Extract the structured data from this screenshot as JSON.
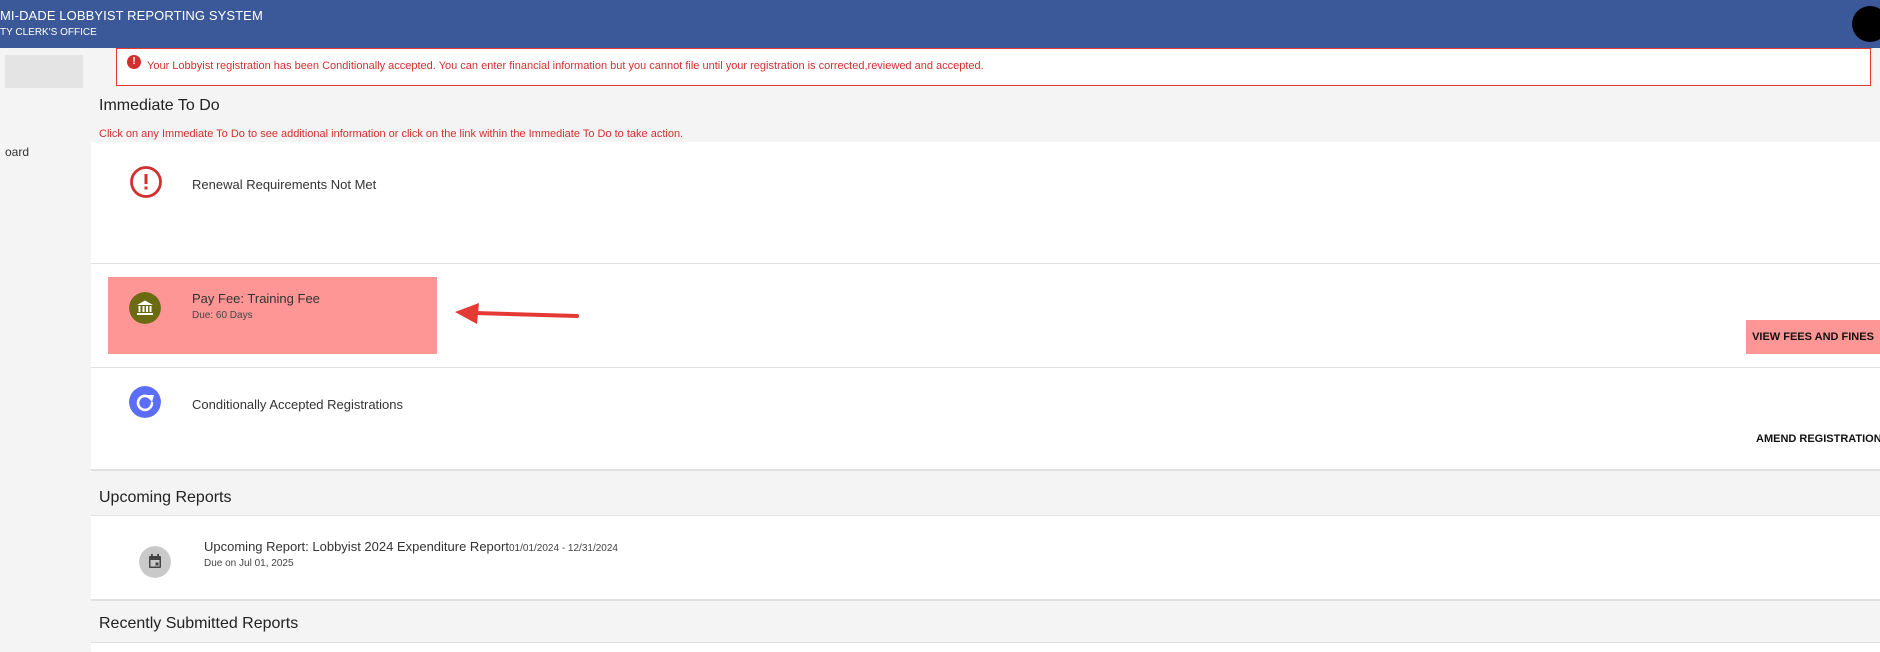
{
  "header": {
    "title": "MI-DADE LOBBYIST REPORTING SYSTEM",
    "subtitle": "TY CLERK'S OFFICE"
  },
  "sidebar": {
    "items": [
      {
        "label": ""
      },
      {
        "label": "oard"
      }
    ]
  },
  "alert": {
    "text": "Your Lobbyist registration has been Conditionally accepted. You can enter financial information but you cannot file until your registration is corrected,reviewed and accepted."
  },
  "immediate_todo": {
    "heading": "Immediate To Do",
    "instructions": "Click on any Immediate To Do to see additional information or click on the link within the Immediate To Do to take action.",
    "items": [
      {
        "title": "Renewal Requirements Not Met",
        "subtitle": "",
        "action": ""
      },
      {
        "title": "Pay Fee: Training Fee",
        "subtitle": "Due: 60 Days",
        "action": "VIEW FEES AND FINES"
      },
      {
        "title": "Conditionally Accepted Registrations",
        "subtitle": "",
        "action": "AMEND REGISTRATION"
      }
    ]
  },
  "upcoming_reports": {
    "heading": "Upcoming Reports",
    "items": [
      {
        "title": "Upcoming Report: Lobbyist 2024 Expenditure Report",
        "date_range": "01/01/2024 - 12/31/2024",
        "due": "Due on Jul 01, 2025"
      }
    ]
  },
  "recently_submitted": {
    "heading": "Recently Submitted Reports"
  },
  "colors": {
    "header_bg": "#3b5998",
    "alert_red": "#d32f2f",
    "highlight_pink": "#ff9696",
    "bank_icon_bg": "#6b6b12",
    "redo_icon_bg": "#5c6ef8",
    "calendar_icon_bg": "#c9c9c9",
    "annotation_arrow": "#e53935"
  }
}
